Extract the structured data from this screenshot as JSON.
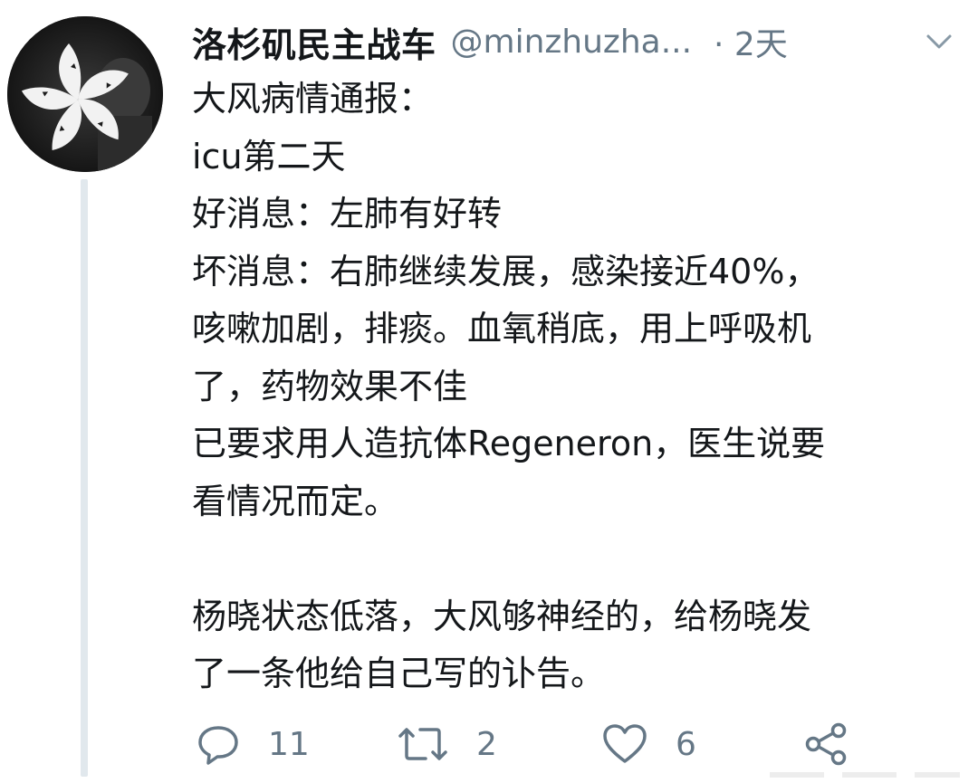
{
  "tweet": {
    "display_name": "洛杉矶民主战车",
    "handle": "@minzhuzha...",
    "time": "· 2天",
    "body_lines": [
      "大风病情通报：",
      "icu第二天",
      "好消息：左肺有好转",
      "坏消息：右肺继续发展，感染接近40%，",
      "咳嗽加剧，排痰。血氧稍底，用上呼吸机",
      "了，药物效果不佳",
      "已要求用人造抗体Regeneron，医生说要",
      "看情况而定。",
      "",
      "杨晓状态低落，大风够神经的，给杨晓发",
      "了一条他给自己写的讣告。"
    ],
    "actions": {
      "reply_count": "11",
      "retweet_count": "2",
      "like_count": "6"
    }
  },
  "icons": {
    "avatar": "bauhinia-flag-avatar",
    "caret": "chevron-down-icon",
    "reply": "reply-icon",
    "retweet": "retweet-icon",
    "like": "heart-icon",
    "share": "share-icon"
  },
  "colors": {
    "text": "#14171a",
    "secondary": "#657786",
    "thread_line": "#e1e8ed"
  }
}
